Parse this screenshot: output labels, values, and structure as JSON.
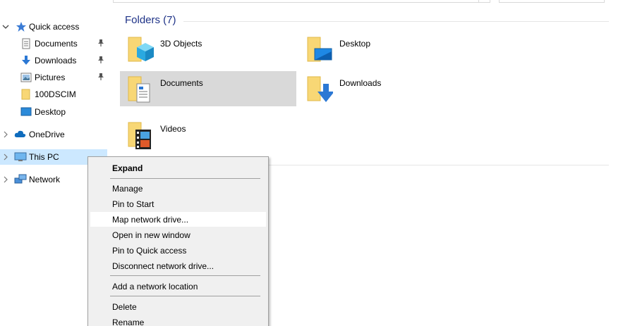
{
  "nav": {
    "quick_access": "Quick access",
    "qa_items": [
      {
        "label": "Documents",
        "icon": "documents-icon",
        "pinned": true
      },
      {
        "label": "Downloads",
        "icon": "downloads-icon",
        "pinned": true
      },
      {
        "label": "Pictures",
        "icon": "pictures-icon",
        "pinned": true
      },
      {
        "label": "100DSCIM",
        "icon": "folder-icon",
        "pinned": false
      },
      {
        "label": "Desktop",
        "icon": "desktop-icon",
        "pinned": false
      }
    ],
    "onedrive": "OneDrive",
    "this_pc": "This PC",
    "network": "Network"
  },
  "main": {
    "group_header": "Folders (7)",
    "folders": [
      {
        "label": "3D Objects",
        "icon": "3d-objects-folder-icon"
      },
      {
        "label": "Desktop",
        "icon": "desktop-folder-icon"
      },
      {
        "label": "Documents",
        "icon": "documents-folder-icon",
        "selected": true
      },
      {
        "label": "Downloads",
        "icon": "downloads-folder-icon"
      },
      {
        "label": "Videos",
        "icon": "videos-folder-icon"
      }
    ]
  },
  "context_menu": {
    "items": [
      {
        "label": "Expand",
        "bold": true
      },
      {
        "label": "Manage"
      },
      {
        "label": "Pin to Start"
      },
      {
        "label": "Map network drive...",
        "hover": true
      },
      {
        "label": "Open in new window"
      },
      {
        "label": "Pin to Quick access"
      },
      {
        "label": "Disconnect network drive..."
      },
      {
        "label": "Add a network location"
      },
      {
        "label": "Delete"
      },
      {
        "label": "Rename"
      }
    ]
  },
  "colors": {
    "selection": "#cce8ff",
    "header_blue": "#1e3287",
    "folder_yellow": "#f8d775",
    "menu_bg": "#f0f0f0"
  }
}
